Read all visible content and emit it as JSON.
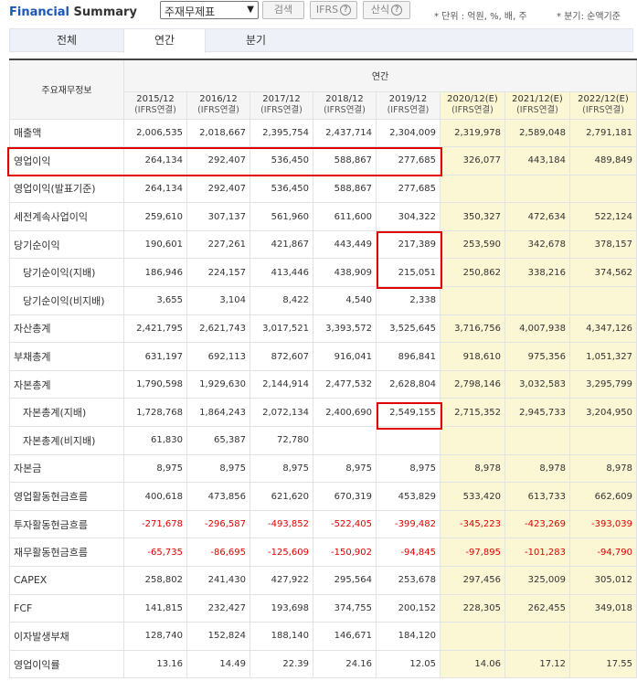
{
  "header": {
    "title_part1": "Financial",
    "title_part2": "Summary",
    "select_value": "주재무제표",
    "search_button": "검색",
    "ifrs_button": "IFRS",
    "sansik_button": "산식",
    "unit_note": "* 단위 : 억원, %, 배, 주",
    "basis_note": "* 분기: 순액기준"
  },
  "tabs": [
    "전체",
    "연간",
    "분기"
  ],
  "active_tab": 1,
  "table": {
    "row_header_label": "주요재무정보",
    "group_header": "연간",
    "columns": [
      {
        "period": "2015/12",
        "basis": "(IFRS연결)",
        "estimate": false
      },
      {
        "period": "2016/12",
        "basis": "(IFRS연결)",
        "estimate": false
      },
      {
        "period": "2017/12",
        "basis": "(IFRS연결)",
        "estimate": false
      },
      {
        "period": "2018/12",
        "basis": "(IFRS연결)",
        "estimate": false
      },
      {
        "period": "2019/12",
        "basis": "(IFRS연결)",
        "estimate": false
      },
      {
        "period": "2020/12(E)",
        "basis": "(IFRS연결)",
        "estimate": true
      },
      {
        "period": "2021/12(E)",
        "basis": "(IFRS연결)",
        "estimate": true
      },
      {
        "period": "2022/12(E)",
        "basis": "(IFRS연결)",
        "estimate": true
      }
    ],
    "rows": [
      {
        "label": "매출액",
        "indent": false,
        "values": [
          "2,006,535",
          "2,018,667",
          "2,395,754",
          "2,437,714",
          "2,304,009",
          "2,319,978",
          "2,589,048",
          "2,791,181"
        ]
      },
      {
        "label": "영업이익",
        "indent": false,
        "values": [
          "264,134",
          "292,407",
          "536,450",
          "588,867",
          "277,685",
          "326,077",
          "443,184",
          "489,849"
        ]
      },
      {
        "label": "영업이익(발표기준)",
        "indent": false,
        "values": [
          "264,134",
          "292,407",
          "536,450",
          "588,867",
          "277,685",
          "",
          "",
          ""
        ]
      },
      {
        "label": "세전계속사업이익",
        "indent": false,
        "values": [
          "259,610",
          "307,137",
          "561,960",
          "611,600",
          "304,322",
          "350,327",
          "472,634",
          "522,124"
        ]
      },
      {
        "label": "당기순이익",
        "indent": false,
        "values": [
          "190,601",
          "227,261",
          "421,867",
          "443,449",
          "217,389",
          "253,590",
          "342,678",
          "378,157"
        ]
      },
      {
        "label": "당기순이익(지배)",
        "indent": true,
        "values": [
          "186,946",
          "224,157",
          "413,446",
          "438,909",
          "215,051",
          "250,862",
          "338,216",
          "374,562"
        ]
      },
      {
        "label": "당기순이익(비지배)",
        "indent": true,
        "values": [
          "3,655",
          "3,104",
          "8,422",
          "4,540",
          "2,338",
          "",
          "",
          ""
        ]
      },
      {
        "label": "자산총계",
        "indent": false,
        "values": [
          "2,421,795",
          "2,621,743",
          "3,017,521",
          "3,393,572",
          "3,525,645",
          "3,716,756",
          "4,007,938",
          "4,347,126"
        ]
      },
      {
        "label": "부채총계",
        "indent": false,
        "values": [
          "631,197",
          "692,113",
          "872,607",
          "916,041",
          "896,841",
          "918,610",
          "975,356",
          "1,051,327"
        ]
      },
      {
        "label": "자본총계",
        "indent": false,
        "values": [
          "1,790,598",
          "1,929,630",
          "2,144,914",
          "2,477,532",
          "2,628,804",
          "2,798,146",
          "3,032,583",
          "3,295,799"
        ]
      },
      {
        "label": "자본총계(지배)",
        "indent": true,
        "values": [
          "1,728,768",
          "1,864,243",
          "2,072,134",
          "2,400,690",
          "2,549,155",
          "2,715,352",
          "2,945,733",
          "3,204,950"
        ]
      },
      {
        "label": "자본총계(비지배)",
        "indent": true,
        "values": [
          "61,830",
          "65,387",
          "72,780",
          "",
          "",
          "",
          "",
          ""
        ]
      },
      {
        "label": "자본금",
        "indent": false,
        "values": [
          "8,975",
          "8,975",
          "8,975",
          "8,975",
          "8,975",
          "8,978",
          "8,978",
          "8,978"
        ]
      },
      {
        "label": "영업활동현금흐름",
        "indent": false,
        "values": [
          "400,618",
          "473,856",
          "621,620",
          "670,319",
          "453,829",
          "533,420",
          "613,733",
          "662,609"
        ]
      },
      {
        "label": "투자활동현금흐름",
        "indent": false,
        "values": [
          "-271,678",
          "-296,587",
          "-493,852",
          "-522,405",
          "-399,482",
          "-345,223",
          "-423,269",
          "-393,039"
        ]
      },
      {
        "label": "재무활동현금흐름",
        "indent": false,
        "values": [
          "-65,735",
          "-86,695",
          "-125,609",
          "-150,902",
          "-94,845",
          "-97,895",
          "-101,283",
          "-94,790"
        ]
      },
      {
        "label": "CAPEX",
        "indent": false,
        "values": [
          "258,802",
          "241,430",
          "427,922",
          "295,564",
          "253,678",
          "297,456",
          "325,009",
          "305,012"
        ]
      },
      {
        "label": "FCF",
        "indent": false,
        "values": [
          "141,815",
          "232,427",
          "193,698",
          "374,755",
          "200,152",
          "228,305",
          "262,455",
          "349,018"
        ]
      },
      {
        "label": "이자발생부채",
        "indent": false,
        "values": [
          "128,740",
          "152,824",
          "188,140",
          "146,671",
          "184,120",
          "",
          "",
          ""
        ]
      },
      {
        "label": "영업이익률",
        "indent": false,
        "values": [
          "13.16",
          "14.49",
          "22.39",
          "24.16",
          "12.05",
          "14.06",
          "17.12",
          "17.55"
        ]
      }
    ]
  },
  "colors": {
    "title_blue": "#1a56b8",
    "highlight_red": "#e00000",
    "negative_red": "#e00000",
    "estimate_bg": "#fbf6d3"
  }
}
